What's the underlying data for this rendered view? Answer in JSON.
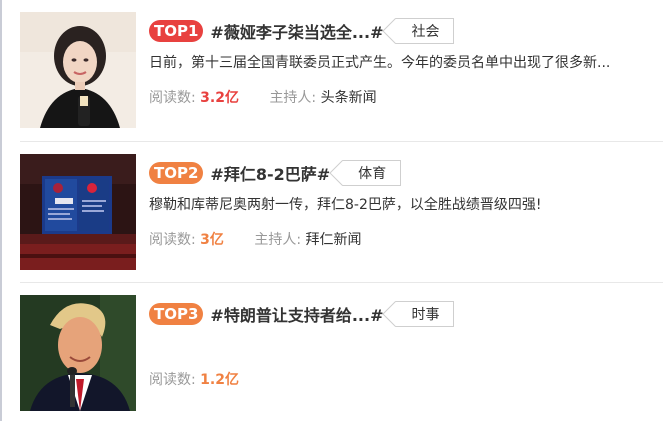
{
  "topics": [
    {
      "rank": "TOP1",
      "title": "#薇娅李子柒当选全...#",
      "tag": "社会",
      "description": "日前，第十三届全国青联委员正式产生。今年的委员名单中出现了很多新...",
      "read_label": "阅读数:",
      "read_count": "3.2亿",
      "host_label": "主持人:",
      "host": "头条新闻"
    },
    {
      "rank": "TOP2",
      "title": "#拜仁8-2巴萨#",
      "tag": "体育",
      "description": "穆勒和库蒂尼奥两射一传，拜仁8-2巴萨，以全胜战绩晋级四强!",
      "read_label": "阅读数:",
      "read_count": "3亿",
      "host_label": "主持人:",
      "host": "拜仁新闻"
    },
    {
      "rank": "TOP3",
      "title": "#特朗普让支持者给...#",
      "tag": "时事",
      "description": "",
      "read_label": "阅读数:",
      "read_count": "1.2亿"
    }
  ],
  "colors": {
    "top1_badge": "#e8413f",
    "top_badge": "#f08142",
    "read_count": "#e8413f",
    "meta_text": "#999999"
  }
}
